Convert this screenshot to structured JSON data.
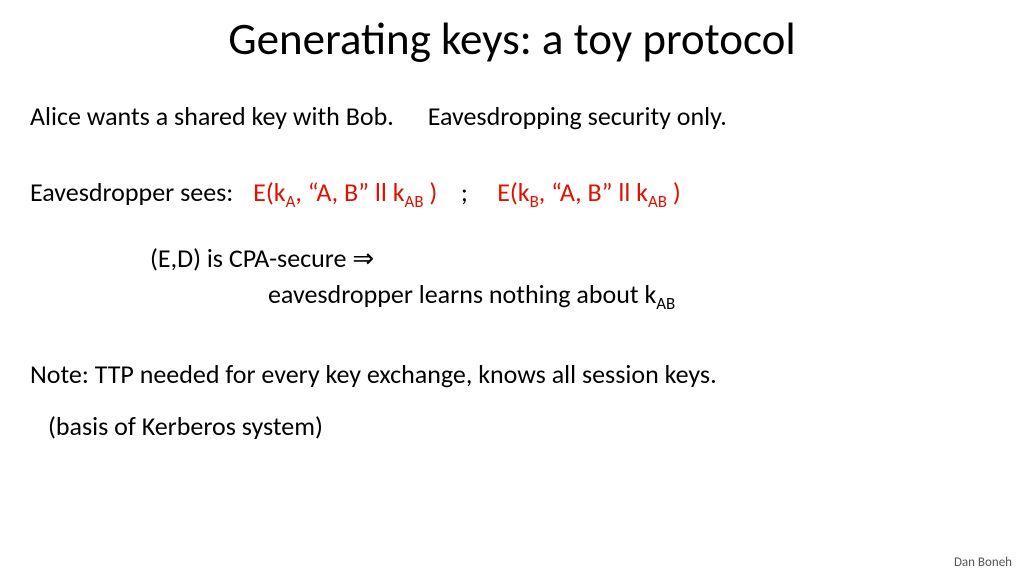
{
  "title": "Generating keys: a toy protocol",
  "line1_a": "Alice wants a shared key with Bob.",
  "line1_b": "Eavesdropping security only.",
  "line2_label": "Eavesdropper sees:",
  "expr1_pre": "E(k",
  "expr1_sub1": "A",
  "expr1_mid": ",    “A, B” ll k",
  "expr1_sub2": "AB",
  "expr1_post": " )",
  "sep": ";",
  "expr2_pre": "E(k",
  "expr2_sub1": "B",
  "expr2_mid": ",    “A, B” ll k",
  "expr2_sub2": "AB",
  "expr2_post": " )",
  "line3": "(E,D) is CPA-secure  ⇒",
  "line4_a": "eavesdropper learns nothing about k",
  "line4_sub": "AB",
  "line5": "Note:  TTP needed for every key exchange,   knows all session keys.",
  "line6": "(basis of Kerberos system)",
  "footer": "Dan Boneh"
}
